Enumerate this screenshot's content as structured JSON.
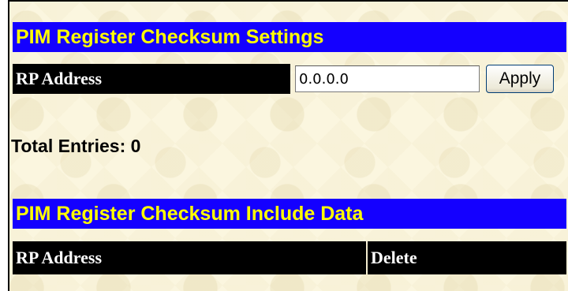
{
  "settings_section": {
    "title": "PIM Register Checksum Settings",
    "rp_address_label": "RP Address",
    "rp_address_value": "0.0.0.0",
    "apply_label": "Apply"
  },
  "summary": {
    "total_entries_text": "Total Entries:  0"
  },
  "include_data_section": {
    "title": "PIM Register Checksum Include Data",
    "columns": [
      "RP Address",
      "Delete"
    ]
  },
  "colors": {
    "header_bg": "#1400ff",
    "header_text": "#ffff00",
    "label_bg": "#000000",
    "label_text": "#ffffff",
    "page_bg": "#fbf6df"
  }
}
